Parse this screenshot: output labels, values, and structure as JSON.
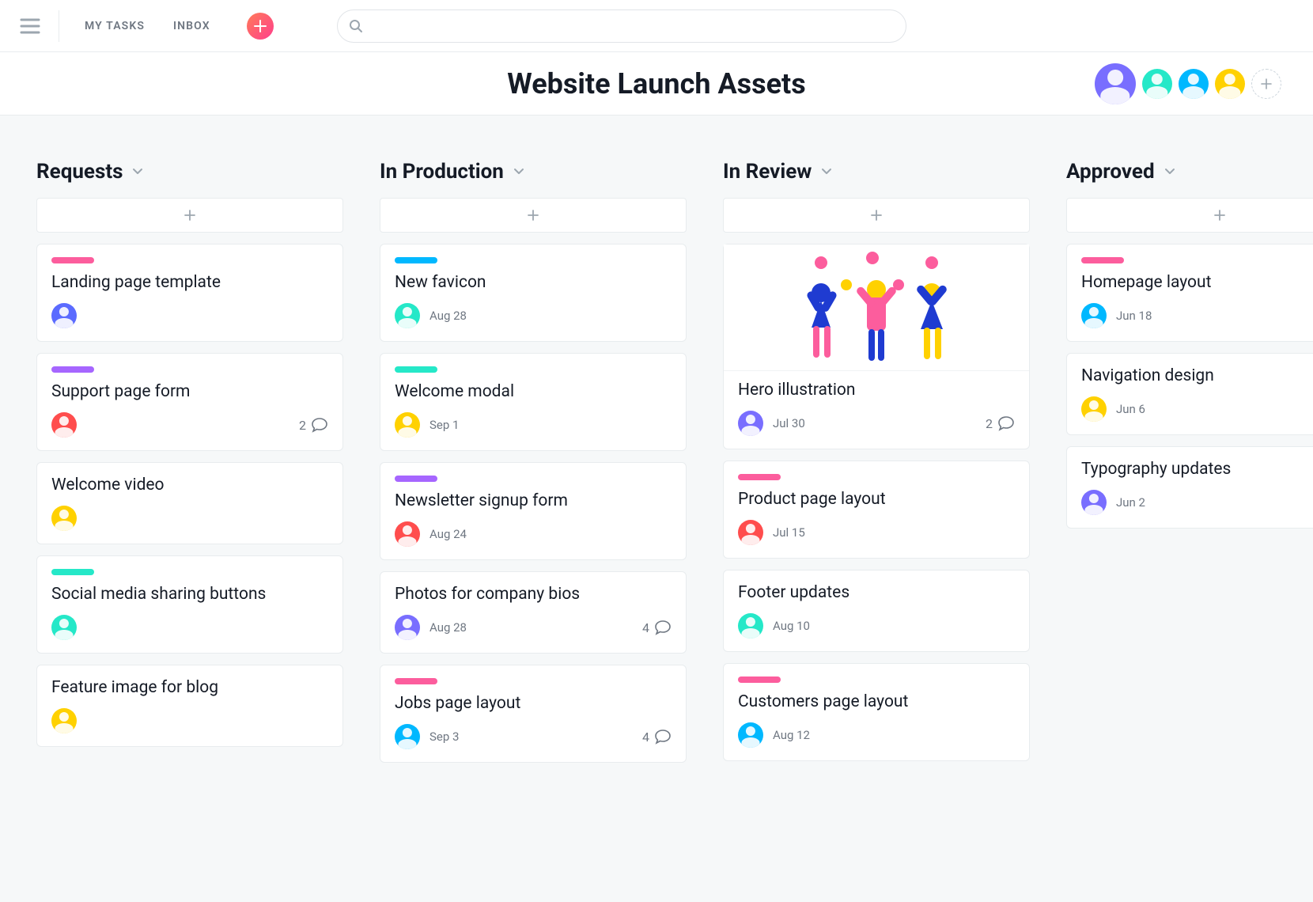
{
  "nav": {
    "my_tasks": "MY TASKS",
    "inbox": "INBOX"
  },
  "search": {
    "placeholder": ""
  },
  "project": {
    "title": "Website Launch Assets"
  },
  "members": [
    {
      "name": "member-1",
      "bg": "#796eff"
    },
    {
      "name": "member-2",
      "bg": "#25e8c8"
    },
    {
      "name": "member-3",
      "bg": "#00b8ff"
    },
    {
      "name": "member-4",
      "bg": "#ffd100"
    }
  ],
  "columns": [
    {
      "title": "Requests",
      "cards": [
        {
          "pill": "#fc5d9d",
          "title": "Landing page template",
          "avatar_bg": "#5b6bff",
          "date": ""
        },
        {
          "pill": "#a666ff",
          "title": "Support page form",
          "avatar_bg": "#ff4d4d",
          "date": "",
          "comments": 2
        },
        {
          "pill": null,
          "title": "Welcome video",
          "avatar_bg": "#ffd100",
          "date": ""
        },
        {
          "pill": "#25e8c8",
          "title": "Social media sharing buttons",
          "avatar_bg": "#25e8c8",
          "date": ""
        },
        {
          "pill": null,
          "title": "Feature image for blog",
          "avatar_bg": "#ffd100",
          "date": ""
        }
      ]
    },
    {
      "title": "In Production",
      "cards": [
        {
          "pill": "#00b8ff",
          "title": "New favicon",
          "avatar_bg": "#25e8c8",
          "date": "Aug 28"
        },
        {
          "pill": "#25e8c8",
          "title": "Welcome modal",
          "avatar_bg": "#ffd100",
          "date": "Sep 1"
        },
        {
          "pill": "#a666ff",
          "title": "Newsletter signup form",
          "avatar_bg": "#ff4d4d",
          "date": "Aug 24"
        },
        {
          "pill": null,
          "title": "Photos for company bios",
          "avatar_bg": "#796eff",
          "date": "Aug 28",
          "comments": 4
        },
        {
          "pill": "#fc5d9d",
          "title": "Jobs page layout",
          "avatar_bg": "#00b8ff",
          "date": "Sep 3",
          "comments": 4
        }
      ]
    },
    {
      "title": "In Review",
      "cards": [
        {
          "cover": true,
          "pill": null,
          "title": "Hero illustration",
          "avatar_bg": "#796eff",
          "date": "Jul 30",
          "comments": 2
        },
        {
          "pill": "#fc5d9d",
          "title": "Product page layout",
          "avatar_bg": "#ff4d4d",
          "date": "Jul 15"
        },
        {
          "pill": null,
          "title": "Footer updates",
          "avatar_bg": "#25e8c8",
          "date": "Aug 10"
        },
        {
          "pill": "#fc5d9d",
          "title": "Customers page layout",
          "avatar_bg": "#00b8ff",
          "date": "Aug 12"
        }
      ]
    },
    {
      "title": "Approved",
      "cards": [
        {
          "pill": "#fc5d9d",
          "title": "Homepage layout",
          "avatar_bg": "#00b8ff",
          "date": "Jun 18"
        },
        {
          "pill": null,
          "title": "Navigation design",
          "avatar_bg": "#ffd100",
          "date": "Jun 6"
        },
        {
          "pill": null,
          "title": "Typography updates",
          "avatar_bg": "#796eff",
          "date": "Jun 2"
        }
      ]
    }
  ]
}
